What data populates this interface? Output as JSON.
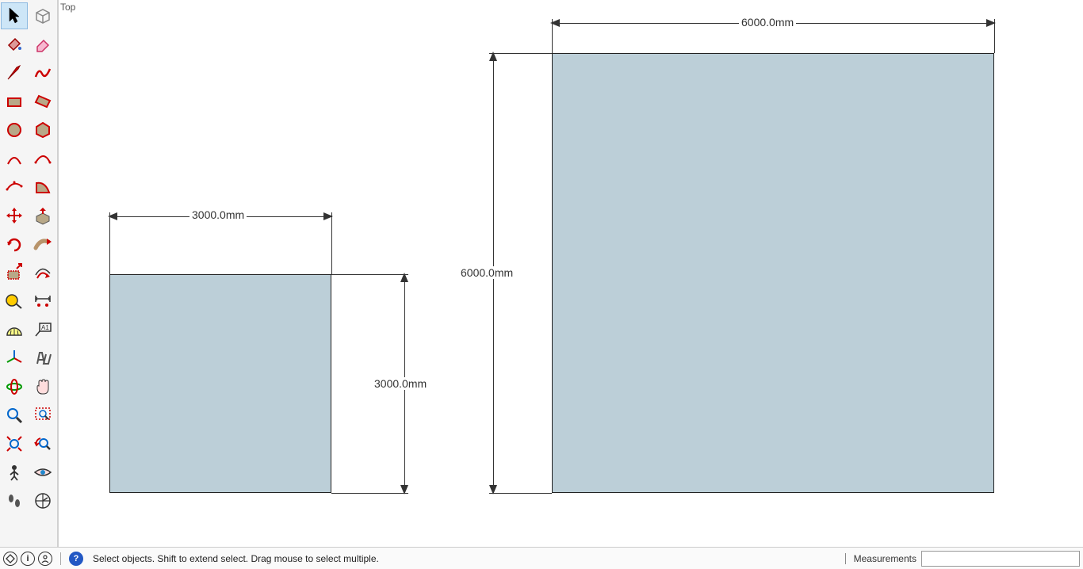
{
  "view": {
    "label": "Top"
  },
  "status": {
    "hint": "Select objects. Shift to extend select. Drag mouse to select multiple.",
    "measurements_label": "Measurements",
    "measurements_value": ""
  },
  "toolbar": {
    "rows": [
      [
        "select",
        "component"
      ],
      [
        "paint",
        "eraser"
      ],
      [
        "line",
        "freehand"
      ],
      [
        "rectangle",
        "rotrect"
      ],
      [
        "circle",
        "polygon"
      ],
      [
        "arc",
        "arc2pt"
      ],
      [
        "arc3pt",
        "pie"
      ],
      [
        "move",
        "pushpull"
      ],
      [
        "rotate",
        "followme"
      ],
      [
        "scale",
        "offset"
      ],
      [
        "tape",
        "dimension"
      ],
      [
        "protractor",
        "text"
      ],
      [
        "axes",
        "3dtext"
      ],
      [
        "orbit",
        "pan"
      ],
      [
        "zoom",
        "zoomwin"
      ],
      [
        "zoomext",
        "prev"
      ],
      [
        "position",
        "look"
      ],
      [
        "walk",
        "section"
      ]
    ]
  },
  "shapes": {
    "small": {
      "width_label": "3000.0mm",
      "height_label": "3000.0mm"
    },
    "large": {
      "width_label": "6000.0mm",
      "height_label": "6000.0mm"
    }
  }
}
